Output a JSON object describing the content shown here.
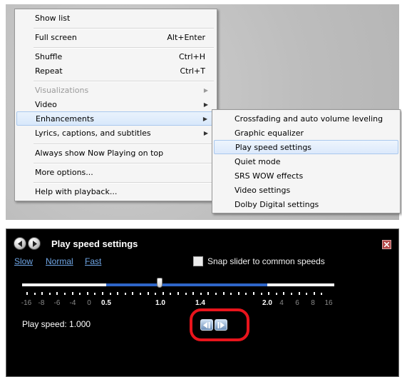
{
  "main_menu": {
    "items": [
      {
        "label": "Show list",
        "shortcut": "",
        "submenu": false,
        "disabled": false
      },
      {
        "label": "Full screen",
        "shortcut": "Alt+Enter",
        "submenu": false,
        "disabled": false
      },
      {
        "label": "Shuffle",
        "shortcut": "Ctrl+H",
        "submenu": false,
        "disabled": false
      },
      {
        "label": "Repeat",
        "shortcut": "Ctrl+T",
        "submenu": false,
        "disabled": false
      },
      {
        "label": "Visualizations",
        "shortcut": "",
        "submenu": true,
        "disabled": true
      },
      {
        "label": "Video",
        "shortcut": "",
        "submenu": true,
        "disabled": false
      },
      {
        "label": "Enhancements",
        "shortcut": "",
        "submenu": true,
        "disabled": false,
        "highlighted": true
      },
      {
        "label": "Lyrics, captions, and subtitles",
        "shortcut": "",
        "submenu": true,
        "disabled": false
      },
      {
        "label": "Always show Now Playing on top",
        "shortcut": "",
        "submenu": false,
        "disabled": false
      },
      {
        "label": "More options...",
        "shortcut": "",
        "submenu": false,
        "disabled": false
      },
      {
        "label": "Help with playback...",
        "shortcut": "",
        "submenu": false,
        "disabled": false
      }
    ]
  },
  "sub_menu": {
    "items": [
      {
        "label": "Crossfading and auto volume leveling"
      },
      {
        "label": "Graphic equalizer"
      },
      {
        "label": "Play speed settings",
        "highlighted": true
      },
      {
        "label": "Quiet mode"
      },
      {
        "label": "SRS WOW effects"
      },
      {
        "label": "Video settings"
      },
      {
        "label": "Dolby Digital settings"
      }
    ]
  },
  "play_speed": {
    "title": "Play speed settings",
    "links": {
      "slow": "Slow",
      "normal": "Normal",
      "fast": "Fast"
    },
    "snap_label": "Snap slider to common speeds",
    "snap_checked": false,
    "readout": "Play speed: 1.000",
    "current_speed": 1.0,
    "tick_labels": [
      {
        "text": "-16",
        "bright": false
      },
      {
        "text": "-8",
        "bright": false
      },
      {
        "text": "-6",
        "bright": false
      },
      {
        "text": "-4",
        "bright": false
      },
      {
        "text": "0",
        "bright": false
      },
      {
        "text": "0.5",
        "bright": true
      },
      {
        "text": "1.0",
        "bright": true
      },
      {
        "text": "1.4",
        "bright": true
      },
      {
        "text": "2.0",
        "bright": true
      },
      {
        "text": "4",
        "bright": false
      },
      {
        "text": "6",
        "bright": false
      },
      {
        "text": "8",
        "bright": false
      },
      {
        "text": "16",
        "bright": false
      }
    ],
    "colors": {
      "track": "#ffffff",
      "track_active": "#2f66c9",
      "highlight": "#e8141c",
      "link": "#6fa6e6"
    }
  }
}
